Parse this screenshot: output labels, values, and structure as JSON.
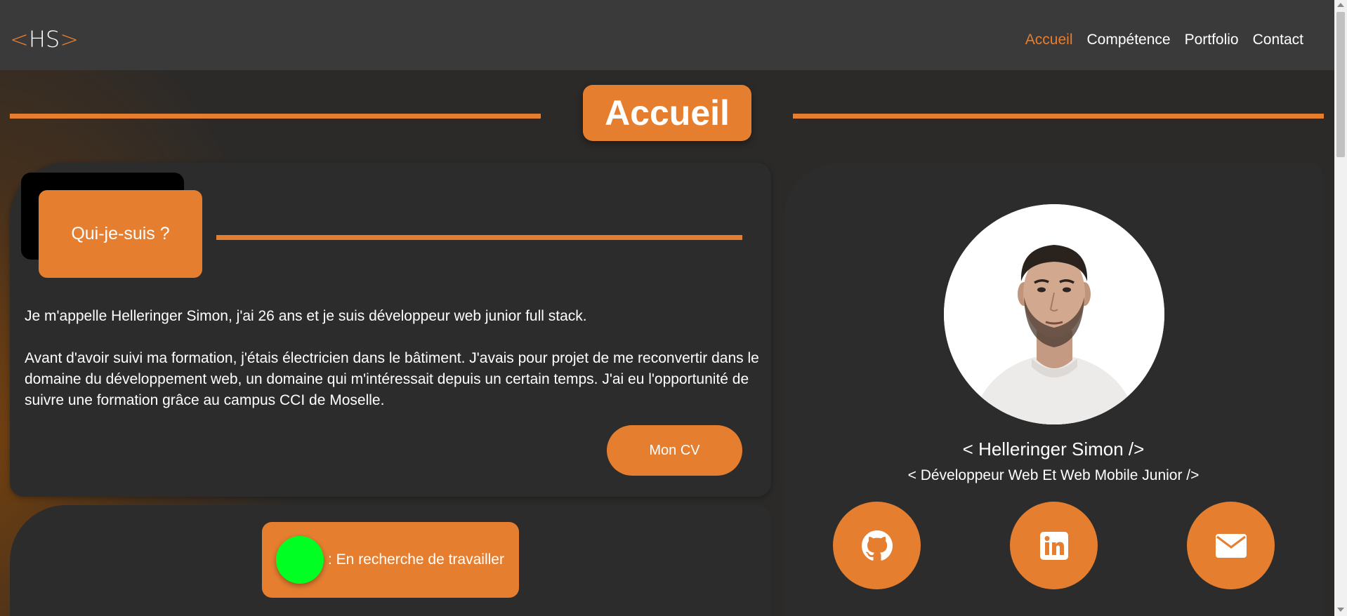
{
  "header": {
    "logo": {
      "open": "<",
      "text": "HS",
      "close": ">"
    },
    "nav": [
      {
        "label": "Accueil",
        "active": true
      },
      {
        "label": "Compétence",
        "active": false
      },
      {
        "label": "Portfolio",
        "active": false
      },
      {
        "label": "Contact",
        "active": false
      }
    ]
  },
  "section": {
    "title": "Accueil"
  },
  "about": {
    "heading": "Qui-je-suis ?",
    "paragraphs": [
      "Je m'appelle Helleringer Simon, j'ai 26 ans et je suis développeur web junior full stack.",
      "Avant d'avoir suivi ma formation, j'étais électricien dans le bâtiment. J'avais pour projet de me reconvertir dans le domaine du développement web, un domaine qui m'intéressait depuis un certain temps. J'ai eu l'opportunité de suivre une formation grâce au campus CCI de Moselle."
    ],
    "cv_button": "Mon CV"
  },
  "status": {
    "text": ": En recherche de travailler",
    "color": "#00ff22"
  },
  "profile": {
    "name": "< Helleringer Simon />",
    "role": "< Développeur Web Et Web Mobile Junior />",
    "social": [
      {
        "icon": "github-icon"
      },
      {
        "icon": "linkedin-icon"
      },
      {
        "icon": "mail-icon"
      }
    ]
  },
  "colors": {
    "accent": "#e67e30",
    "header_bg": "#3a3a3a",
    "page_bg": "#2b2a29",
    "card_bg": "#2c2c2c"
  }
}
